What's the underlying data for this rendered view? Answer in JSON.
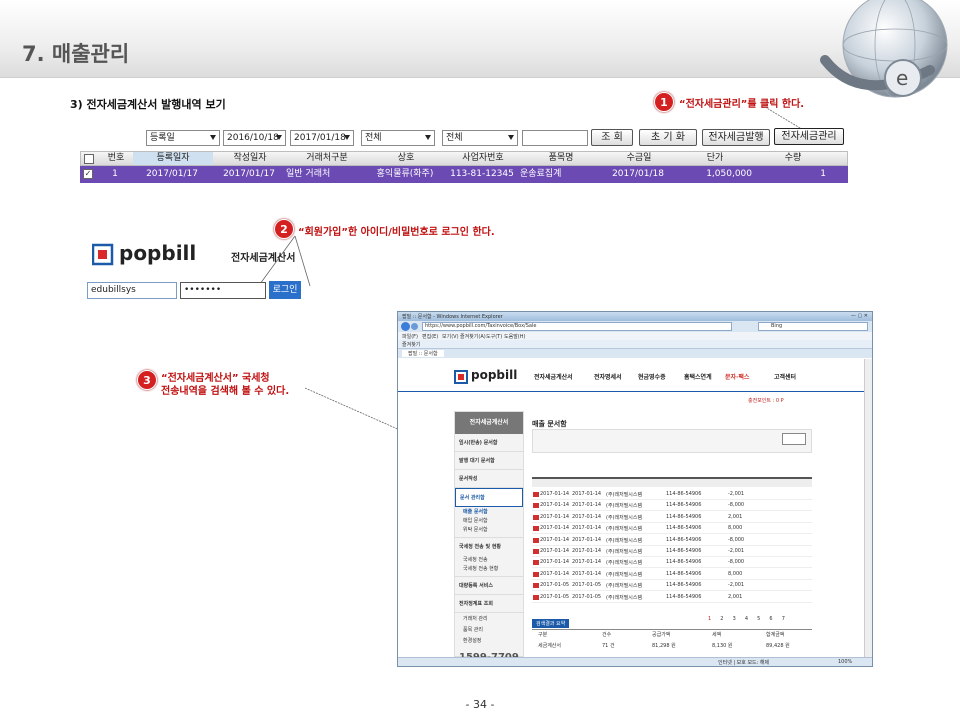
{
  "header": {
    "title": "7. 매출관리"
  },
  "section": {
    "title": "3) 전자세금계산서 발행내역 보기"
  },
  "steps": [
    {
      "num": "1",
      "text": "“전자세금관리”를 클릭 한다."
    },
    {
      "num": "2",
      "text": "“회원가입”한 아이디/비밀번호로 로그인 한다."
    },
    {
      "num": "3",
      "line1": "“전자세금계산서” 국세청",
      "line2": "전송내역을 검색해 볼 수 있다."
    }
  ],
  "search": {
    "date_type": "등록일",
    "date_from": "2016/10/18",
    "date_to": "2017/01/18",
    "filter1": "전체",
    "filter2": "전체",
    "buttons": {
      "search": "조 회",
      "reset": "초 기 화",
      "issue": "전자세금발행",
      "manage": "전자세금관리"
    }
  },
  "grid": {
    "headers": [
      "번호",
      "등록일자",
      "작성일자",
      "거래처구분",
      "상호",
      "사업자번호",
      "품목명",
      "수금일",
      "단가",
      "수량"
    ],
    "row": [
      "1",
      "2017/01/17",
      "2017/01/17",
      "일반 거래처",
      "홍익물류(화주)",
      "113-81-12345",
      "운송료집계",
      "2017/01/18",
      "1,050,000",
      "1"
    ]
  },
  "login": {
    "logo": "popbill",
    "label": "전자세금계산서",
    "username": "edubillsys",
    "password": "•••••••",
    "button": "로그인"
  },
  "browser": {
    "title": "팝빌 :: 문서함 - Windows Internet Explorer",
    "url": "https://www.popbill.com/Taxinvoice/Box/Sale",
    "search_engine": "Bing",
    "menu": [
      "파일(F)",
      "편집(E)",
      "보기(V)",
      "즐겨찾기(A)",
      "도구(T)",
      "도움말(H)"
    ],
    "favorites": "즐겨찾기",
    "tab": "팝빌 :: 문서함",
    "status": "인터넷 | 보호 모드: 해제",
    "zoom": "100%"
  },
  "popbill_app": {
    "logo": "popbill",
    "nav": [
      "전자세금계산서",
      "전자명세서",
      "현금영수증",
      "홈택스연계",
      "문자·팩스",
      "고객센터"
    ],
    "sidebar_title": "전자세금계산서",
    "sidebar_items": [
      "임시(반송) 문서함",
      "발행 대기 문서함",
      "문서작성",
      "문서 관리함",
      "국세청 전송 및 현황",
      "대량등록 서비스",
      "전자정계표 조회"
    ],
    "sidebar_sub": [
      "매출 문서함",
      "매입 문서함",
      "위탁 문서함"
    ],
    "sidebar_sub2": [
      "국세청 전송",
      "국세청 전송 현황"
    ],
    "sidebar_misc": [
      "거래처 관리",
      "품목 관리",
      "환경설정"
    ],
    "phone": "1599-7709",
    "content_title": "매출 문서함",
    "point": "충전포인트 : 0 P",
    "rows": [
      [
        "2017-01-14",
        "2017-01-14",
        "(주)래저필시스템",
        "114-86-54906",
        "-2,001"
      ],
      [
        "2017-01-14",
        "2017-01-14",
        "(주)래저필시스템",
        "114-86-54906",
        "-8,000"
      ],
      [
        "2017-01-14",
        "2017-01-14",
        "(주)래저필시스템",
        "114-86-54906",
        "2,001"
      ],
      [
        "2017-01-14",
        "2017-01-14",
        "(주)래저필시스템",
        "114-86-54906",
        "8,000"
      ],
      [
        "2017-01-14",
        "2017-01-14",
        "(주)래저필시스템",
        "114-86-54906",
        "-8,000"
      ],
      [
        "2017-01-14",
        "2017-01-14",
        "(주)래저필시스템",
        "114-86-54906",
        "-2,001"
      ],
      [
        "2017-01-14",
        "2017-01-14",
        "(주)래저필시스템",
        "114-86-54906",
        "-8,000"
      ],
      [
        "2017-01-14",
        "2017-01-14",
        "(주)래저필시스템",
        "114-86-54906",
        "8,000"
      ],
      [
        "2017-01-05",
        "2017-01-05",
        "(주)래저필시스템",
        "114-86-54906",
        "-2,001"
      ],
      [
        "2017-01-05",
        "2017-01-05",
        "(주)래저필시스템",
        "114-86-54906",
        "2,001"
      ]
    ],
    "pager": [
      "1",
      "2",
      "3",
      "4",
      "5",
      "6",
      "7"
    ],
    "summary": {
      "tab": "검색결과 요약",
      "headers": [
        "구분",
        "건수",
        "공급가액",
        "세액",
        "합계금액"
      ],
      "row": [
        "세금계산서",
        "71 건",
        "81,298 원",
        "8,130 원",
        "89,428 원"
      ]
    }
  },
  "footer": {
    "page": "- 34 -"
  }
}
